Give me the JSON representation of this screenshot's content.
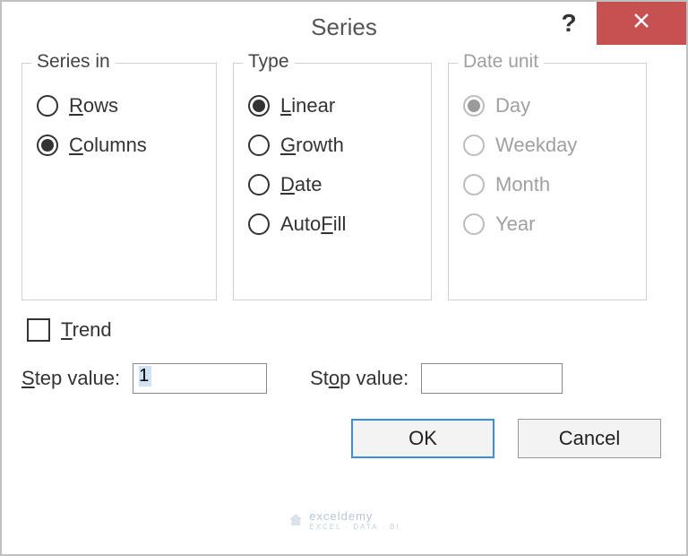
{
  "title": "Series",
  "groups": {
    "series_in": {
      "title": "Series in",
      "options": [
        {
          "label_pre": "",
          "accel": "R",
          "label_post": "ows",
          "selected": false
        },
        {
          "label_pre": "",
          "accel": "C",
          "label_post": "olumns",
          "selected": true
        }
      ]
    },
    "type": {
      "title": "Type",
      "options": [
        {
          "label_pre": "",
          "accel": "L",
          "label_post": "inear",
          "selected": true
        },
        {
          "label_pre": "",
          "accel": "G",
          "label_post": "rowth",
          "selected": false
        },
        {
          "label_pre": "",
          "accel": "D",
          "label_post": "ate",
          "selected": false
        },
        {
          "label_pre": "Auto",
          "accel": "F",
          "label_post": "ill",
          "selected": false
        }
      ]
    },
    "date_unit": {
      "title": "Date unit",
      "disabled": true,
      "options": [
        {
          "label": "Day",
          "selected": true
        },
        {
          "label": "Weekday",
          "selected": false
        },
        {
          "label": "Month",
          "selected": false
        },
        {
          "label": "Year",
          "selected": false
        }
      ]
    }
  },
  "trend": {
    "label_accel": "T",
    "label_post": "rend",
    "checked": false
  },
  "step": {
    "label_pre": "",
    "accel": "S",
    "label_post": "tep value:",
    "value": "1"
  },
  "stop": {
    "label_pre": "St",
    "accel": "o",
    "label_post": "p value:",
    "value": ""
  },
  "buttons": {
    "ok": "OK",
    "cancel": "Cancel"
  },
  "watermark": {
    "main": "exceldemy",
    "sub": "EXCEL · DATA · BI"
  }
}
